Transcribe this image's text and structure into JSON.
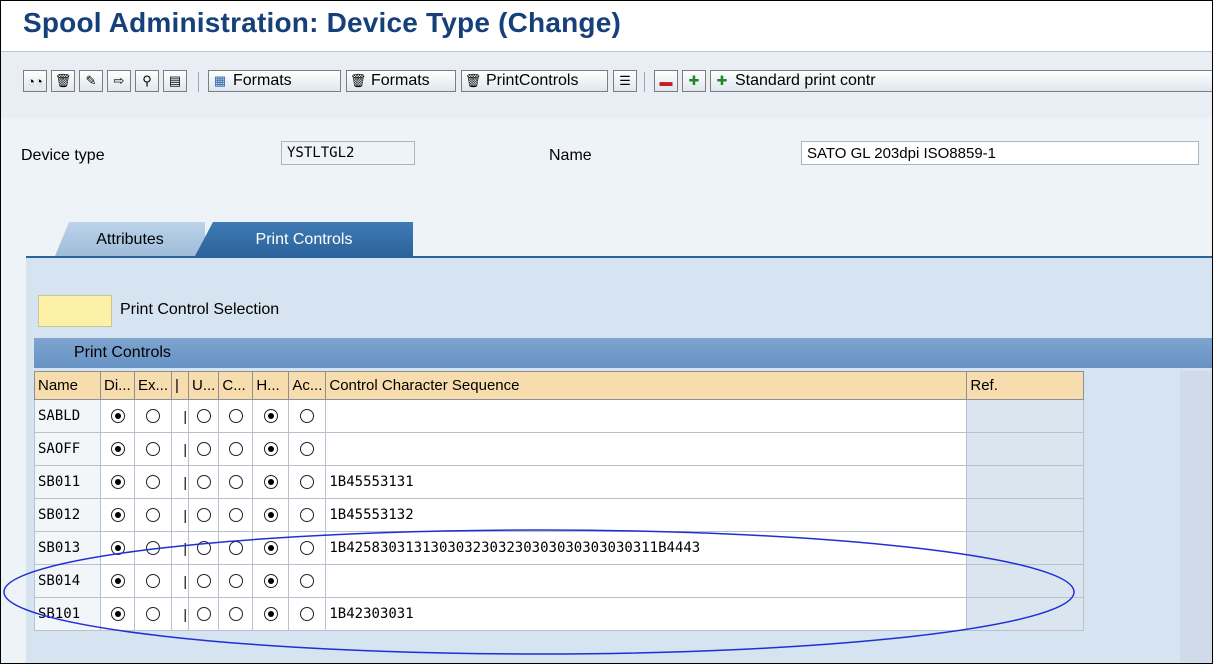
{
  "window": {
    "title": "Spool Administration: Device Type (Change)"
  },
  "toolbar": {
    "icons": [
      "glasses-icon",
      "trash-icon",
      "rename-icon",
      "copy-icon",
      "where-used-icon",
      "print-icon"
    ],
    "formats_label": "Formats",
    "delete_formats_label": "Formats",
    "print_controls_label": "PrintControls",
    "standard_print_label": "Standard print contr"
  },
  "header": {
    "device_type_label": "Device type",
    "device_type_value": "YSTLTGL2",
    "name_label": "Name",
    "name_value": "SATO GL 203dpi ISO8859-1"
  },
  "tabs": [
    {
      "label": "Attributes",
      "active": false
    },
    {
      "label": "Print Controls",
      "active": true
    }
  ],
  "legend": {
    "label": "Print Control Selection",
    "color": "#fdf0a7"
  },
  "grid": {
    "title": "Print Controls",
    "columns": [
      "Name",
      "Di...",
      "Ex...",
      "|",
      "U...",
      "C...",
      "H...",
      "Ac...",
      "Control Character Sequence",
      "Ref."
    ],
    "rows": [
      {
        "name": "SABLD",
        "sep": "|",
        "radios": [
          true,
          false,
          false,
          false,
          true,
          false
        ],
        "seq": ""
      },
      {
        "name": "SAOFF",
        "sep": "|",
        "radios": [
          true,
          false,
          false,
          false,
          true,
          false
        ],
        "seq": ""
      },
      {
        "name": "SB011",
        "sep": "|",
        "radios": [
          true,
          false,
          false,
          false,
          true,
          false
        ],
        "seq": "1B45553131"
      },
      {
        "name": "SB012",
        "sep": "|",
        "radios": [
          true,
          false,
          false,
          false,
          true,
          false
        ],
        "seq": "1B45553132"
      },
      {
        "name": "SB013",
        "sep": "|",
        "radios": [
          true,
          false,
          false,
          false,
          true,
          false
        ],
        "seq": "1B4258303131303032303230303030303030311B4443"
      },
      {
        "name": "SB014",
        "sep": "|",
        "radios": [
          true,
          false,
          false,
          false,
          true,
          false
        ],
        "seq": ""
      },
      {
        "name": "SB101",
        "sep": "|",
        "radios": [
          true,
          false,
          false,
          false,
          true,
          false
        ],
        "seq": "1B42303031"
      }
    ]
  },
  "annotation": {
    "shape": "ellipse",
    "color": "#1f2fd6"
  },
  "colors": {
    "title": "#16407a",
    "active_tab": "#2c639c",
    "header_cells": "#f7ddae"
  }
}
